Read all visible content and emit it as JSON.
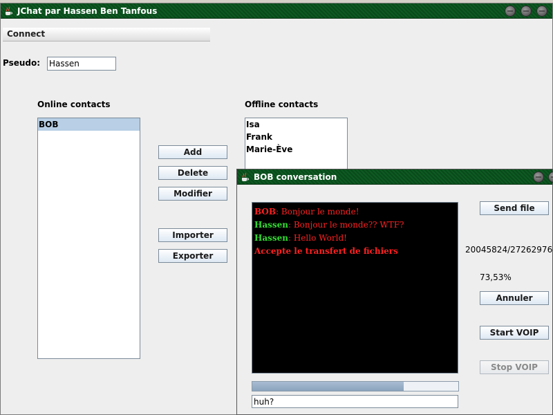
{
  "main_window": {
    "title": "JChat par Hassen Ben Tanfous",
    "menu": {
      "connect": "Connect"
    },
    "pseudo_label": "Pseudo:",
    "pseudo_value": "Hassen",
    "online_label": "Online contacts",
    "offline_label": "Offline contacts",
    "online_contacts": [
      "BOB"
    ],
    "offline_contacts": [
      "Isa",
      "Frank",
      "Marie-Ève"
    ],
    "buttons": {
      "add": "Add",
      "delete": "Delete",
      "modifier": "Modifier",
      "importer": "Importer",
      "exporter": "Exporter"
    }
  },
  "conversation": {
    "title": "BOB conversation",
    "messages": [
      {
        "sender": "BOB",
        "text": ": Bonjour le monde!"
      },
      {
        "sender": "Hassen",
        "text": ": Bonjour le monde?? WTF?"
      },
      {
        "sender": "Hassen",
        "text": ": Hello World!"
      },
      {
        "sender": "",
        "text": "Accepte le transfert de fichiers"
      }
    ],
    "send_file": "Send file",
    "transfer_bytes": "20045824/27262976",
    "transfer_percent": "73,53%",
    "progress_fraction": 0.7353,
    "annuler": "Annuler",
    "start_voip": "Start VOIP",
    "stop_voip": "Stop VOIP",
    "input_value": "huh?"
  },
  "colors": {
    "titlebar": "#0d5a22",
    "sender_bob": "#ff2020",
    "sender_hassen": "#33dd33",
    "message_text": "#ff2020",
    "chat_background": "#000000"
  }
}
